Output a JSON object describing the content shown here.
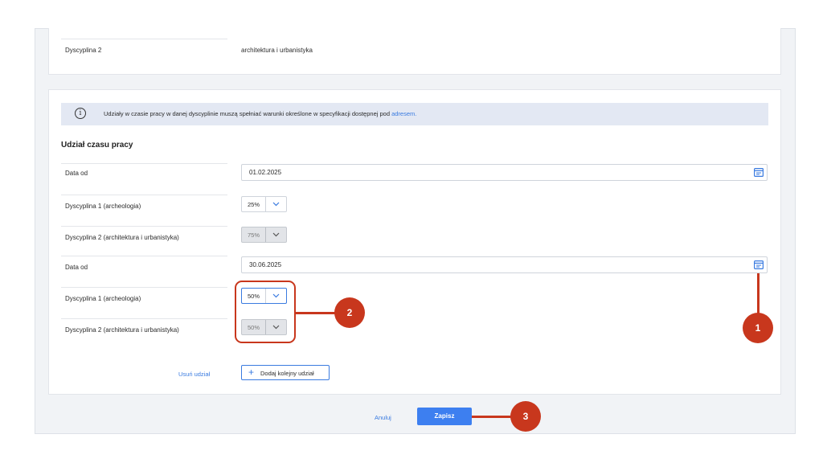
{
  "top_card": {
    "label": "Dyscyplina 2",
    "value": "architektura i urbanistyka"
  },
  "info": {
    "text": "Udziały w czasie pracy w danej dyscyplinie muszą spełniać warunki określone w specyfikacji dostępnej pod ",
    "link": "adresem."
  },
  "section_title": "Udział czasu pracy",
  "periods": [
    {
      "date_label": "Data od",
      "date_value": "01.02.2025",
      "d1_label": "Dyscyplina 1 (archeologia)",
      "d1_value": "25%",
      "d2_label": "Dyscyplina 2 (architektura i urbanistyka)",
      "d2_value": "75%"
    },
    {
      "date_label": "Data od",
      "date_value": "30.06.2025",
      "d1_label": "Dyscyplina 1 (archeologia)",
      "d1_value": "50%",
      "d2_label": "Dyscyplina 2 (architektura i urbanistyka)",
      "d2_value": "50%"
    }
  ],
  "actions": {
    "remove_label": "Usuń udział",
    "add_label": "Dodaj kolejny udział",
    "cancel_label": "Anuluj",
    "save_label": "Zapisz"
  },
  "callouts": [
    "1",
    "2",
    "3"
  ],
  "colors": {
    "accent": "#3d7ff0",
    "callout": "#c8371d",
    "info_bg": "#e3e8f3"
  }
}
